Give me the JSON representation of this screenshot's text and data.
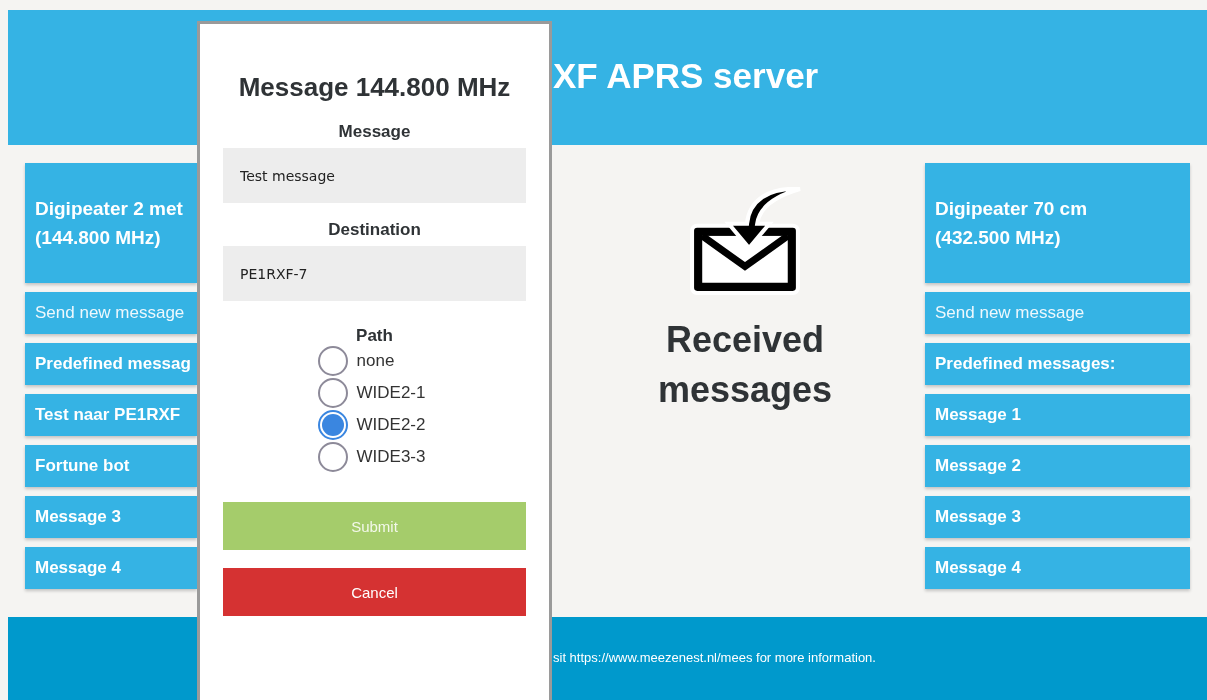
{
  "header": {
    "title": "XF APRS server"
  },
  "left_panel": {
    "heading_lines": [
      "Digipeater 2 met",
      "(144.800 MHz)"
    ],
    "items": [
      {
        "label": "Send new message",
        "kind": "action"
      },
      {
        "label": "Predefined messag",
        "kind": "heading"
      },
      {
        "label": "Test naar PE1RXF",
        "kind": "message"
      },
      {
        "label": "Fortune bot",
        "kind": "message"
      },
      {
        "label": "Message 3",
        "kind": "message"
      },
      {
        "label": "Message 4",
        "kind": "message"
      }
    ]
  },
  "inbox": {
    "title": "Received messages"
  },
  "right_panel": {
    "heading_lines": [
      "Digipeater 70 cm",
      "(432.500 MHz)"
    ],
    "items": [
      {
        "label": "Send new message",
        "kind": "action"
      },
      {
        "label": "Predefined messages:",
        "kind": "heading"
      },
      {
        "label": "Message 1",
        "kind": "message"
      },
      {
        "label": "Message 2",
        "kind": "message"
      },
      {
        "label": "Message 3",
        "kind": "message"
      },
      {
        "label": "Message 4",
        "kind": "message"
      }
    ]
  },
  "footer": {
    "text": "sit https://www.meezenest.nl/mees for more information."
  },
  "dialog": {
    "title": "Message 144.800 MHz",
    "fields": [
      {
        "label": "Message",
        "value": "Test message"
      },
      {
        "label": "Destination",
        "value": "PE1RXF-7"
      }
    ],
    "path": {
      "label": "Path",
      "options": [
        {
          "label": "none",
          "selected": false
        },
        {
          "label": "WIDE2-1",
          "selected": false
        },
        {
          "label": "WIDE2-2",
          "selected": true
        },
        {
          "label": "WIDE3-3",
          "selected": false
        }
      ]
    },
    "buttons": [
      {
        "label": "Submit",
        "kind": "submit"
      },
      {
        "label": "Cancel",
        "kind": "cancel"
      }
    ]
  }
}
